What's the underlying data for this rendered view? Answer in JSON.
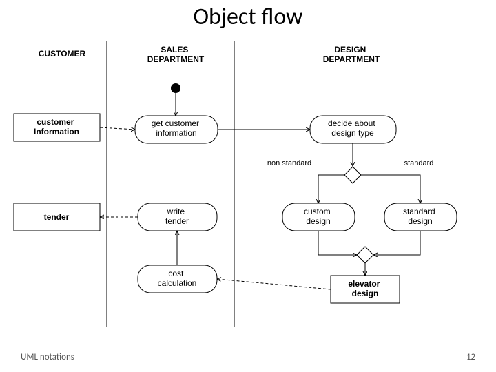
{
  "title": "Object flow",
  "footer_left": "UML notations",
  "footer_right": "12",
  "lanes": {
    "customer": "CUSTOMER",
    "sales": "SALES DEPARTMENT",
    "design": "DESIGN DEPARTMENT"
  },
  "objects": {
    "customer_info": "customer Information",
    "tender": "tender",
    "elevator_design": "elevator design"
  },
  "activities": {
    "get_cust_info": "get customer information",
    "decide_design_type": "decide about design type",
    "write_tender": "write tender",
    "custom_design": "custom design",
    "standard_design": "standard design",
    "cost_calculation": "cost calculation"
  },
  "branch_labels": {
    "non_standard": "non standard",
    "standard": "standard"
  }
}
